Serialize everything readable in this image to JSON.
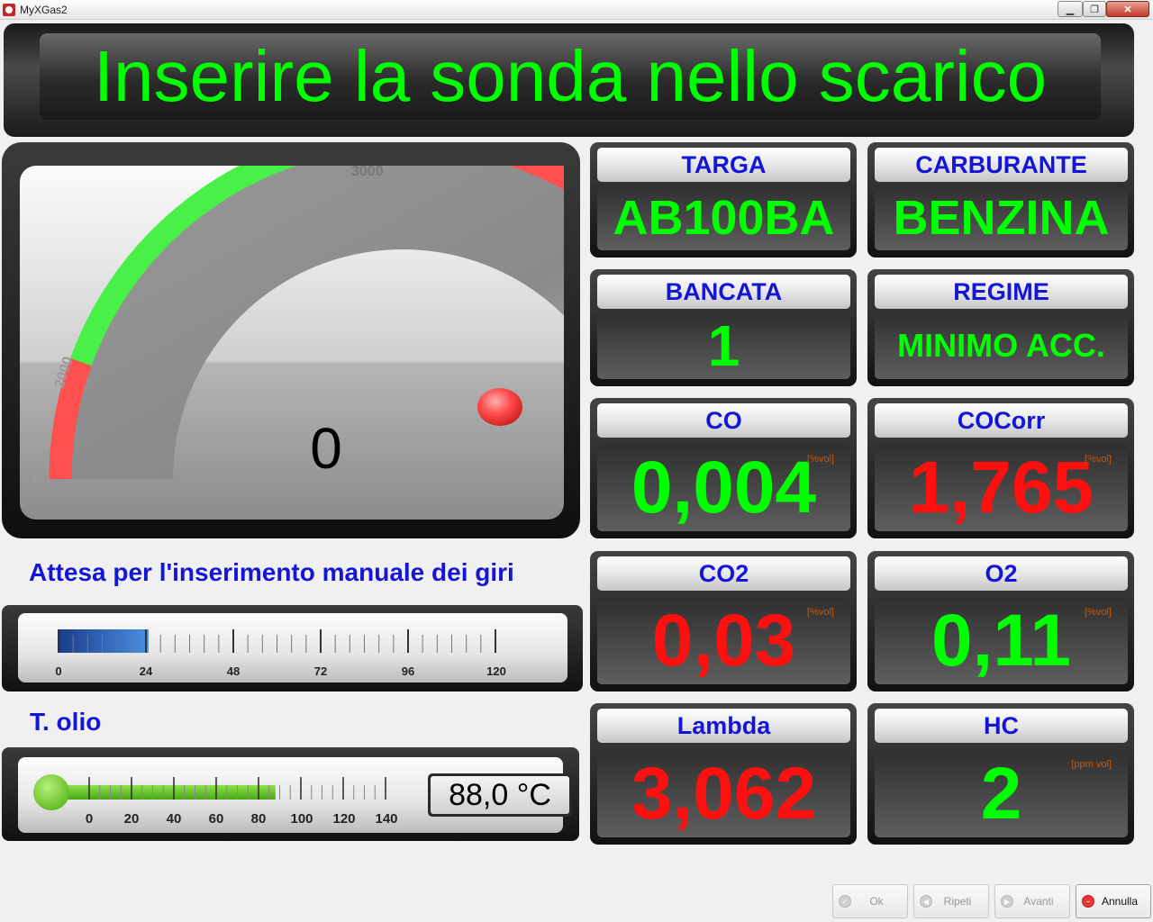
{
  "window": {
    "title": "MyXGas2",
    "min_icon": "minimize-icon",
    "max_icon": "maximize-icon",
    "close_icon": "close-icon"
  },
  "banner": {
    "message": "Inserire la sonda nello scarico"
  },
  "gauge": {
    "value": "0",
    "tick_labels": [
      "0",
      "2000",
      "3000"
    ],
    "zone_colors": {
      "low": "#ff5050",
      "ok": "#48f048",
      "high": "#ff5050"
    },
    "indicator_color": "#ff3b3b"
  },
  "rpm": {
    "title": "Attesa per l'inserimento manuale dei giri",
    "tick_labels": [
      "0",
      "24",
      "48",
      "72",
      "96",
      "120"
    ],
    "scale_max": 120,
    "fill_value": 22
  },
  "oil": {
    "title": "T. olio",
    "tick_labels": [
      "0",
      "20",
      "40",
      "60",
      "80",
      "100",
      "120",
      "140"
    ],
    "readout": "88,0 °C",
    "value": 88.0
  },
  "cards": {
    "targa": {
      "label": "TARGA",
      "value": "AB100BA",
      "unit": ""
    },
    "carburante": {
      "label": "CARBURANTE",
      "value": "BENZINA",
      "unit": ""
    },
    "bancata": {
      "label": "BANCATA",
      "value": "1",
      "unit": ""
    },
    "regime": {
      "label": "REGIME",
      "value": "MINIMO ACC.",
      "unit": ""
    },
    "co": {
      "label": "CO",
      "value": "0,004",
      "unit": "[%vol]"
    },
    "cocorr": {
      "label": "COCorr",
      "value": "1,765",
      "unit": "[%vol]"
    },
    "co2": {
      "label": "CO2",
      "value": "0,03",
      "unit": "[%vol]"
    },
    "o2": {
      "label": "O2",
      "value": "0,11",
      "unit": "[%vol]"
    },
    "lambda": {
      "label": "Lambda",
      "value": "3,062",
      "unit": ""
    },
    "hc": {
      "label": "HC",
      "value": "2",
      "unit": "[ppm vol]"
    }
  },
  "buttons": {
    "ok": {
      "label": "Ok",
      "icon": "check-icon",
      "enabled": false
    },
    "ripeti": {
      "label": "Ripeti",
      "icon": "rewind-icon",
      "enabled": false
    },
    "avanti": {
      "label": "Avanti",
      "icon": "fast-forward-icon",
      "enabled": false
    },
    "annulla": {
      "label": "Annulla",
      "icon": "cancel-icon",
      "enabled": true
    }
  }
}
